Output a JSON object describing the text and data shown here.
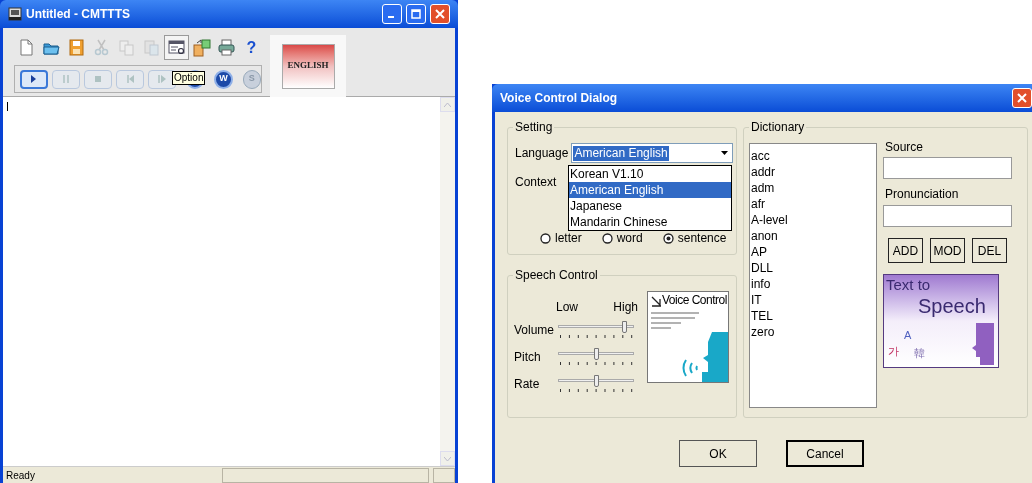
{
  "main_window": {
    "title": "Untitled - CMTTTS",
    "toolbar": [
      {
        "kind": "new",
        "disabled": false,
        "pressed": false
      },
      {
        "kind": "open",
        "disabled": false,
        "pressed": false
      },
      {
        "kind": "save",
        "disabled": false,
        "pressed": false
      },
      {
        "kind": "cut",
        "disabled": true,
        "pressed": false
      },
      {
        "kind": "copy",
        "disabled": true,
        "pressed": false
      },
      {
        "kind": "paste",
        "disabled": true,
        "pressed": false
      },
      {
        "kind": "option",
        "disabled": false,
        "pressed": true
      },
      {
        "kind": "convert",
        "disabled": false,
        "pressed": false
      },
      {
        "kind": "print",
        "disabled": false,
        "pressed": false
      },
      {
        "kind": "help",
        "label": "?",
        "disabled": false,
        "pressed": false
      }
    ],
    "playback": [
      {
        "kind": "play",
        "disabled": false,
        "selected": true
      },
      {
        "kind": "pause",
        "disabled": true,
        "selected": false
      },
      {
        "kind": "stop",
        "disabled": true,
        "selected": false
      },
      {
        "kind": "previous",
        "disabled": true,
        "selected": false
      },
      {
        "kind": "next",
        "disabled": true,
        "selected": false
      },
      {
        "kind": "round",
        "disabled": false,
        "selected": false
      },
      {
        "kind": "round",
        "label": "W",
        "disabled": false,
        "selected": false
      },
      {
        "kind": "round",
        "label": "S",
        "disabled": true,
        "selected": false
      }
    ],
    "tooltip": "Option",
    "language_badge": "ENGLISH",
    "status_bar": {
      "text": "Ready"
    }
  },
  "dialog": {
    "title": "Voice Control Dialog",
    "setting": {
      "title": "Setting",
      "language_label": "Language",
      "language_value": "American English",
      "language_options": [
        {
          "label": "Korean V1.10",
          "selected": false
        },
        {
          "label": "American English",
          "selected": true
        },
        {
          "label": "Japanese",
          "selected": false
        },
        {
          "label": "Mandarin Chinese",
          "selected": false
        }
      ],
      "context_label": "Context",
      "context_options": [
        {
          "label": "letter",
          "selected": false
        },
        {
          "label": "word",
          "selected": false
        },
        {
          "label": "sentence",
          "selected": true
        }
      ]
    },
    "speech_control": {
      "title": "Speech Control",
      "low_label": "Low",
      "high_label": "High",
      "sliders": [
        {
          "label": "Volume",
          "level": 0.9
        },
        {
          "label": "Pitch",
          "level": 0.5
        },
        {
          "label": "Rate",
          "level": 0.5
        }
      ],
      "logo_title": "Voice Control"
    },
    "dictionary": {
      "title": "Dictionary",
      "entries": [
        "acc",
        "addr",
        "adm",
        "afr",
        "A-level",
        "anon",
        "AP",
        "DLL",
        "info",
        "IT",
        "TEL",
        "zero"
      ],
      "source_label": "Source",
      "pronunciation_label": "Pronunciation",
      "buttons": [
        "ADD",
        "MOD",
        "DEL"
      ],
      "banner": {
        "line1": "Text to",
        "line2": "Speech",
        "glyphs": [
          "가",
          "A",
          "韓"
        ]
      }
    },
    "buttons": [
      "OK",
      "Cancel"
    ]
  }
}
